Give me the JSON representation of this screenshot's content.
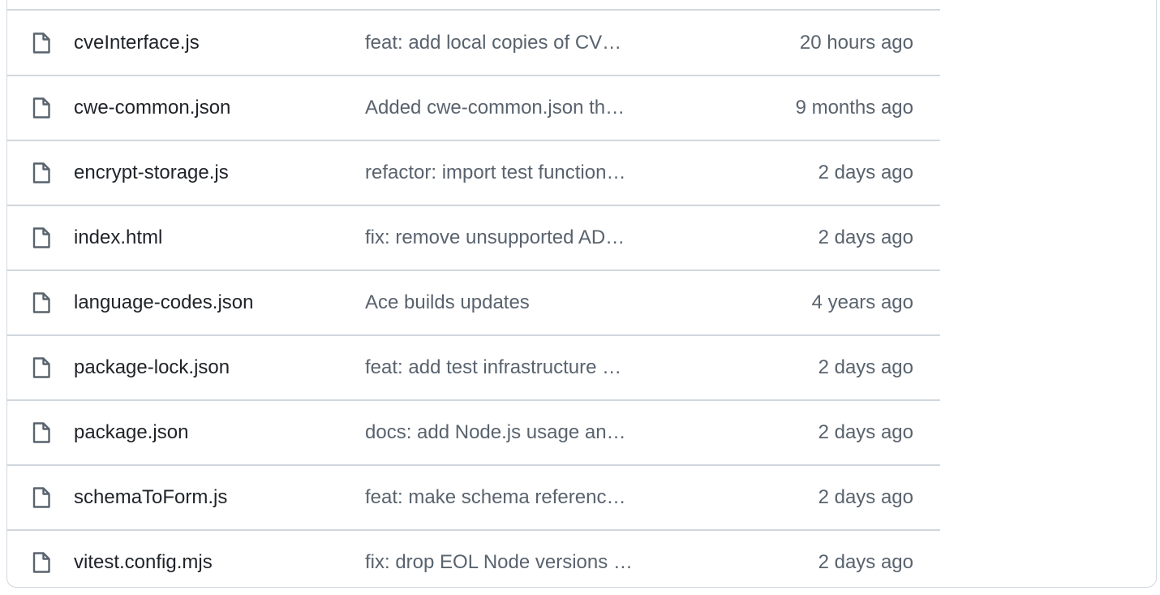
{
  "files": [
    {
      "icon": "file-icon",
      "name": "cveInterface.js",
      "message": "feat: add local copies of CV…",
      "time": "20 hours ago"
    },
    {
      "icon": "file-icon",
      "name": "cwe-common.json",
      "message": "Added cwe-common.json th…",
      "time": "9 months ago"
    },
    {
      "icon": "file-icon",
      "name": "encrypt-storage.js",
      "message": "refactor: import test function…",
      "time": "2 days ago"
    },
    {
      "icon": "file-icon",
      "name": "index.html",
      "message": "fix: remove unsupported AD…",
      "time": "2 days ago"
    },
    {
      "icon": "file-icon",
      "name": "language-codes.json",
      "message": "Ace builds updates",
      "time": "4 years ago"
    },
    {
      "icon": "file-icon",
      "name": "package-lock.json",
      "message": "feat: add test infrastructure …",
      "time": "2 days ago"
    },
    {
      "icon": "file-icon",
      "name": "package.json",
      "message": "docs: add Node.js usage an…",
      "time": "2 days ago"
    },
    {
      "icon": "file-icon",
      "name": "schemaToForm.js",
      "message": "feat: make schema referenc…",
      "time": "2 days ago"
    },
    {
      "icon": "file-icon",
      "name": "vitest.config.mjs",
      "message": "fix: drop EOL Node versions …",
      "time": "2 days ago"
    }
  ]
}
